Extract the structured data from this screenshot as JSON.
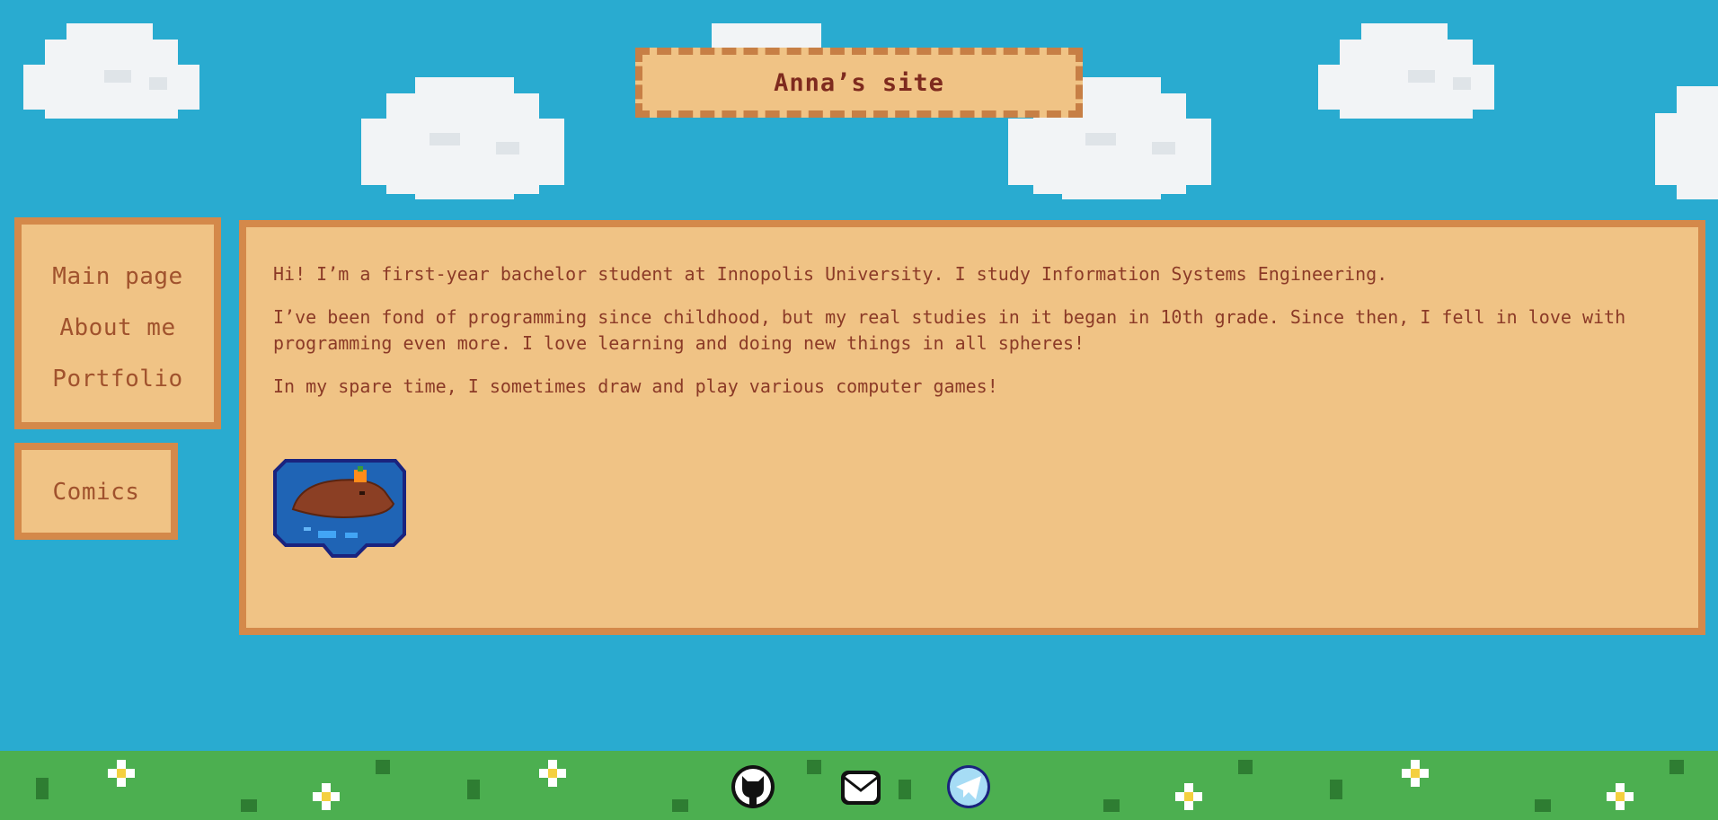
{
  "header": {
    "title": "Anna’s site"
  },
  "nav": {
    "items": [
      {
        "label": "Main page"
      },
      {
        "label": "About me"
      },
      {
        "label": "Portfolio"
      }
    ],
    "comics": {
      "label": "Comics"
    }
  },
  "content": {
    "paragraphs": [
      "Hi! I’m a first-year bachelor student at Innopolis University. I study Information Systems Engineering.",
      "I’ve been fond of programming since childhood, but my real studies in it began in 10th grade. Since then, I fell in love with programming even more. I love learning and doing new things in all spheres!",
      "In my spare time, I sometimes draw and play various computer games!"
    ],
    "image": "capybara-in-pond-pixel-art"
  },
  "footer": {
    "socials": [
      "github-icon",
      "mail-icon",
      "telegram-icon"
    ]
  },
  "colors": {
    "sky": "#29abd0",
    "panel": "#f0c385",
    "panel_border": "#d4894a",
    "text": "#8b3a27",
    "grass": "#4caf50"
  }
}
